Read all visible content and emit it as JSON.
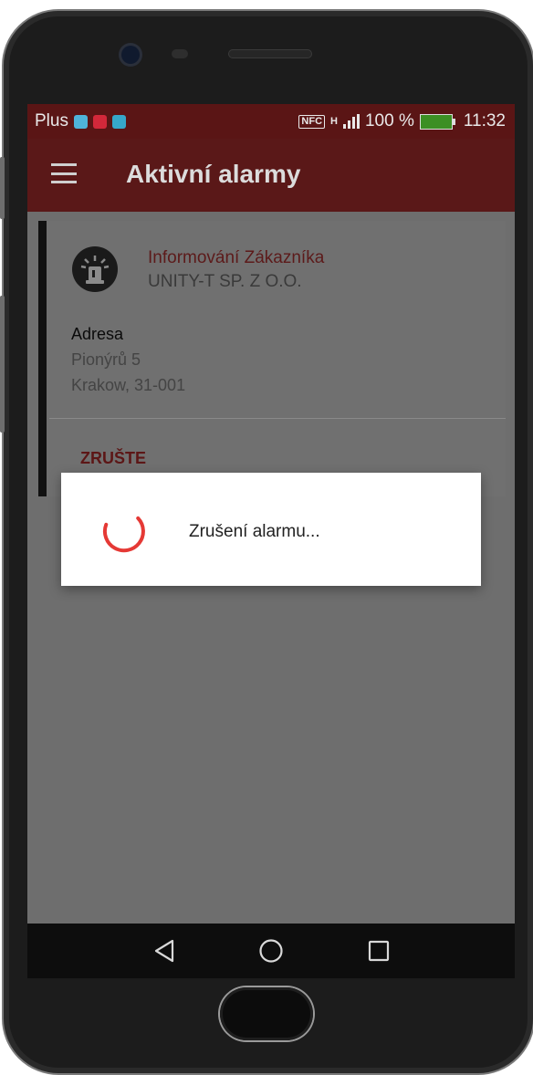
{
  "status_bar": {
    "carrier": "Plus",
    "nfc": "NFC",
    "network": "H",
    "battery_percent": "100 %",
    "time": "11:32",
    "notification_icons": [
      "mail-icon",
      "my-app-icon",
      "shield-app-icon"
    ]
  },
  "app_bar": {
    "title": "Aktivní alarmy",
    "menu_icon": "hamburger-menu-icon"
  },
  "alarm_card": {
    "title": "Informování Zákazníka",
    "subtitle": "UNITY-T SP. Z O.O.",
    "address_label": "Adresa",
    "address_line1": "Pionýrů 5",
    "address_line2": "Krakow, 31-001",
    "action_label": "ZRUŠTE",
    "icon": "siren-icon"
  },
  "progress_dialog": {
    "message": "Zrušení alarmu..."
  },
  "nav_bar": {
    "back_icon": "back-triangle-icon",
    "home_icon": "home-circle-icon",
    "recents_icon": "recents-square-icon"
  },
  "colors": {
    "status_bar": "#5a1515",
    "app_bar": "#5a1818",
    "accent": "#e53935",
    "card_title": "#5c1a1a"
  }
}
